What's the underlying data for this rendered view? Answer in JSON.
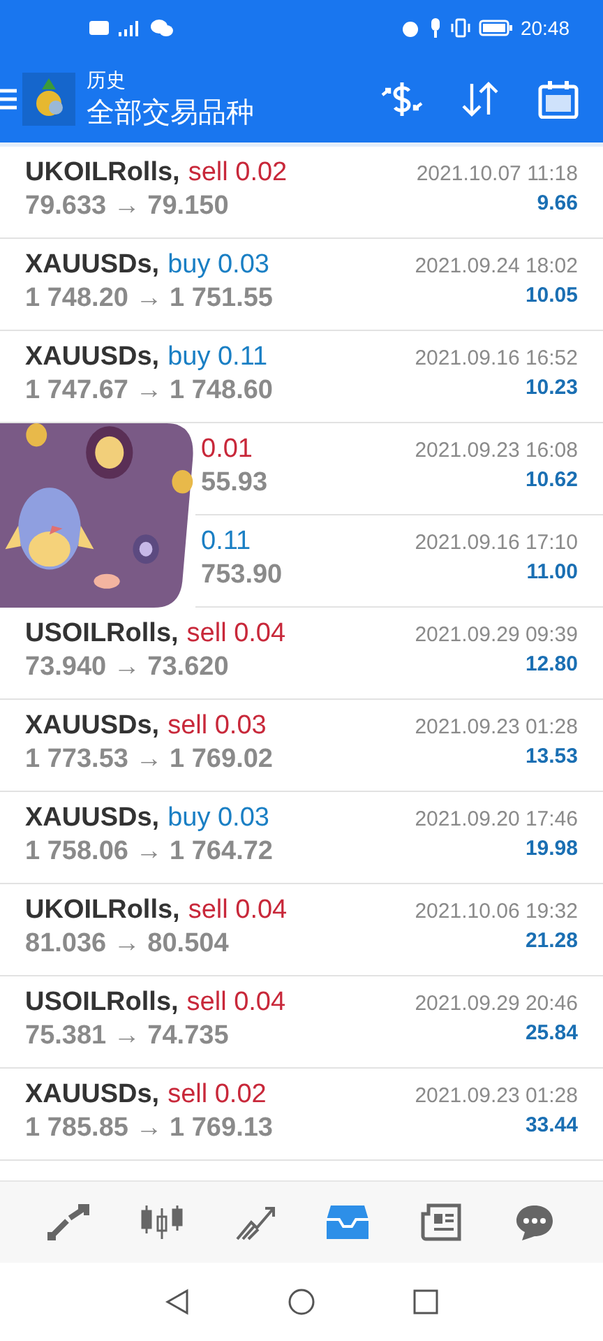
{
  "status_bar": {
    "time": "20:48"
  },
  "header": {
    "subtitle": "历史",
    "title": "全部交易品种"
  },
  "rows": [
    {
      "symbol": "UKOILRolls,",
      "kind": "sell",
      "action": "sell 0.02",
      "prices": "79.633 → 79.150",
      "time": "2021.10.07 11:18",
      "profit": "9.66"
    },
    {
      "symbol": "XAUUSDs,",
      "kind": "buy",
      "action": "buy 0.03",
      "prices": "1 748.20 → 1 751.55",
      "time": "2021.09.24 18:02",
      "profit": "10.05"
    },
    {
      "symbol": "XAUUSDs,",
      "kind": "buy",
      "action": "buy 0.11",
      "prices": "1 747.67 → 1 748.60",
      "time": "2021.09.16 16:52",
      "profit": "10.23"
    },
    {
      "kind": "sell",
      "action": "0.01",
      "prices": "55.93",
      "time": "2021.09.23 16:08",
      "profit": "10.62"
    },
    {
      "kind": "buy",
      "action": "0.11",
      "prices": "753.90",
      "time": "2021.09.16 17:10",
      "profit": "11.00"
    },
    {
      "symbol": "USOILRolls,",
      "kind": "sell",
      "action": "sell 0.04",
      "prices": "73.940 → 73.620",
      "time": "2021.09.29 09:39",
      "profit": "12.80"
    },
    {
      "symbol": "XAUUSDs,",
      "kind": "sell",
      "action": "sell 0.03",
      "prices": "1 773.53 → 1 769.02",
      "time": "2021.09.23 01:28",
      "profit": "13.53"
    },
    {
      "symbol": "XAUUSDs,",
      "kind": "buy",
      "action": "buy 0.03",
      "prices": "1 758.06 → 1 764.72",
      "time": "2021.09.20 17:46",
      "profit": "19.98"
    },
    {
      "symbol": "UKOILRolls,",
      "kind": "sell",
      "action": "sell 0.04",
      "prices": "81.036 → 80.504",
      "time": "2021.10.06 19:32",
      "profit": "21.28"
    },
    {
      "symbol": "USOILRolls,",
      "kind": "sell",
      "action": "sell 0.04",
      "prices": "75.381 → 74.735",
      "time": "2021.09.29 20:46",
      "profit": "25.84"
    },
    {
      "symbol": "XAUUSDs,",
      "kind": "sell",
      "action": "sell 0.02",
      "prices": "1 785.85 → 1 769.13",
      "time": "2021.09.23 01:28",
      "profit": "33.44"
    }
  ],
  "bottom_tabs": [
    {
      "kind": "quotes",
      "selected": false
    },
    {
      "kind": "chart",
      "selected": false
    },
    {
      "kind": "trade",
      "selected": false
    },
    {
      "kind": "history",
      "selected": true
    },
    {
      "kind": "news",
      "selected": false
    },
    {
      "kind": "chat",
      "selected": false
    }
  ]
}
